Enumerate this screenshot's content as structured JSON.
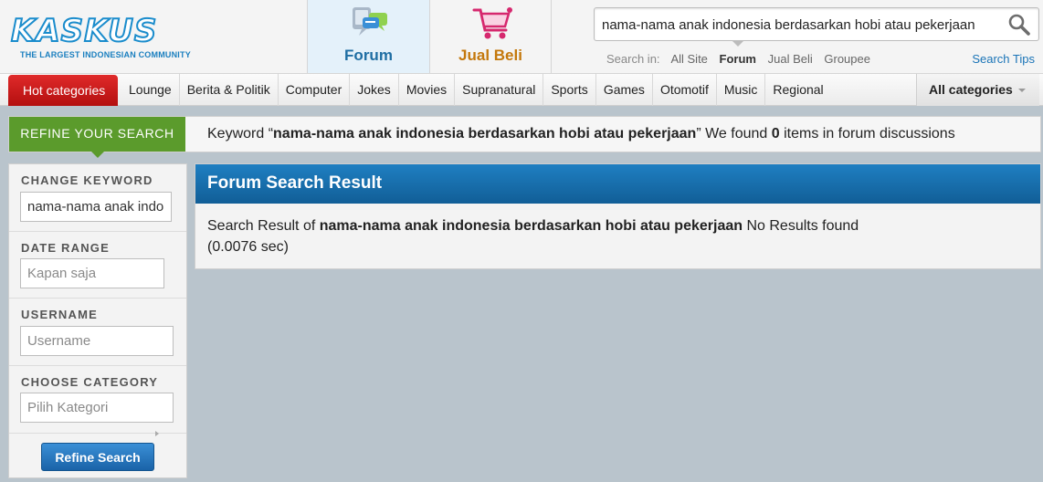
{
  "header": {
    "logo_text": "KASKUS",
    "logo_tagline": "THE LARGEST INDONESIAN COMMUNITY",
    "tabs": [
      {
        "label": "Forum",
        "active": true
      },
      {
        "label": "Jual Beli",
        "active": false
      }
    ],
    "search": {
      "value": "nama-nama anak indonesia berdasarkan hobi atau pekerjaan",
      "search_in_label": "Search in:",
      "options": [
        "All Site",
        "Forum",
        "Jual Beli",
        "Groupee"
      ],
      "active_option": "Forum",
      "tips_label": "Search Tips"
    }
  },
  "categories": {
    "hot_label": "Hot categories",
    "items": [
      "Lounge",
      "Berita & Politik",
      "Computer",
      "Jokes",
      "Movies",
      "Supranatural",
      "Sports",
      "Games",
      "Otomotif",
      "Music",
      "Regional"
    ],
    "all_label": "All categories"
  },
  "refine_bar": {
    "label": "REFINE YOUR SEARCH",
    "prefix": "Keyword “",
    "keyword": "nama-nama anak indonesia berdasarkan hobi atau pekerjaan",
    "middle": "” We found ",
    "count": "0",
    "suffix": " items in forum discussions"
  },
  "sidebar": {
    "change_keyword": {
      "title": "CHANGE KEYWORD",
      "value": "nama-nama anak indonesia berdasarkan hobi atau pekerjaan"
    },
    "date_range": {
      "title": "DATE RANGE",
      "placeholder": "Kapan saja"
    },
    "username": {
      "title": "USERNAME",
      "placeholder": "Username"
    },
    "category": {
      "title": "CHOOSE CATEGORY",
      "placeholder": "Pilih Kategori"
    },
    "button_label": "Refine Search"
  },
  "results": {
    "title": "Forum Search Result",
    "prefix": "Search Result of ",
    "keyword": "nama-nama anak indonesia berdasarkan hobi atau pekerjaan",
    "suffix": " No Results found (0.0076 sec)"
  },
  "colors": {
    "brand_blue": "#1a8ccc",
    "brand_orange": "#f7941d",
    "hot_red": "#c81b1b",
    "refine_green": "#5b9b2c",
    "result_header_blue": "#1a70b0",
    "page_bg": "#b9c4cc"
  }
}
